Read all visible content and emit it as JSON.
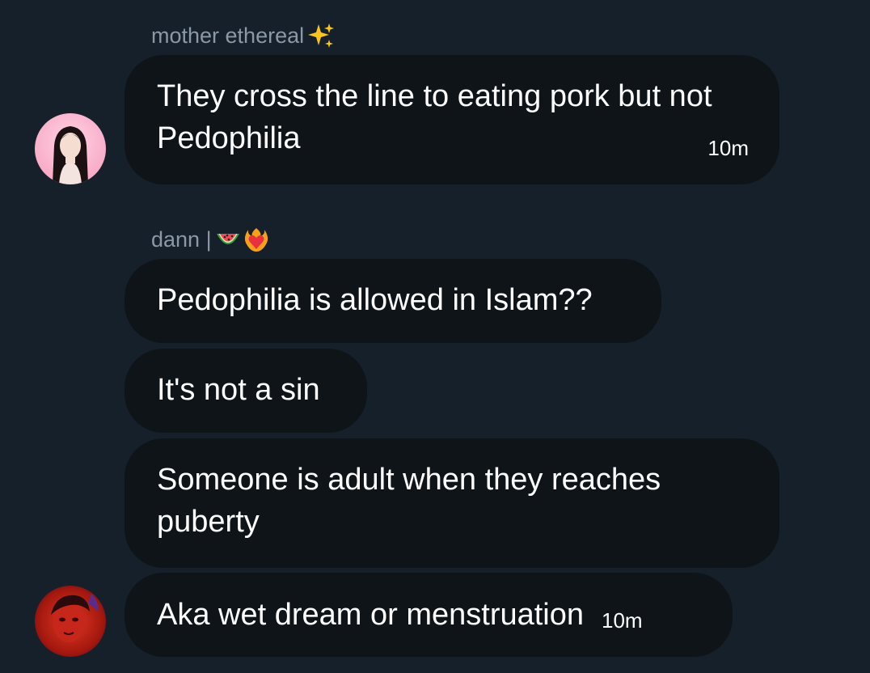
{
  "colors": {
    "background": "#15202b",
    "bubble": "#0f1419",
    "sender_name": "#8b98a5",
    "message_text": "#ffffff"
  },
  "groups": [
    {
      "sender": "mother ethereal",
      "sender_emoji_icons": [
        "sparkles-icon"
      ],
      "avatar_icon": "profile-photo-girl-pink-background",
      "messages": [
        {
          "text": "They cross the line to eating pork but not Pedophilia",
          "time": "10m"
        }
      ]
    },
    {
      "sender": "dann |",
      "sender_emoji_icons": [
        "watermelon-icon",
        "heart-on-fire-icon"
      ],
      "avatar_icon": "profile-photo-red-face",
      "messages": [
        {
          "text": "Pedophilia is allowed in Islam??"
        },
        {
          "text": "It's not a sin"
        },
        {
          "text": "Someone is adult when they reaches puberty"
        },
        {
          "text": "Aka wet dream or menstruation",
          "time": "10m"
        }
      ]
    }
  ]
}
